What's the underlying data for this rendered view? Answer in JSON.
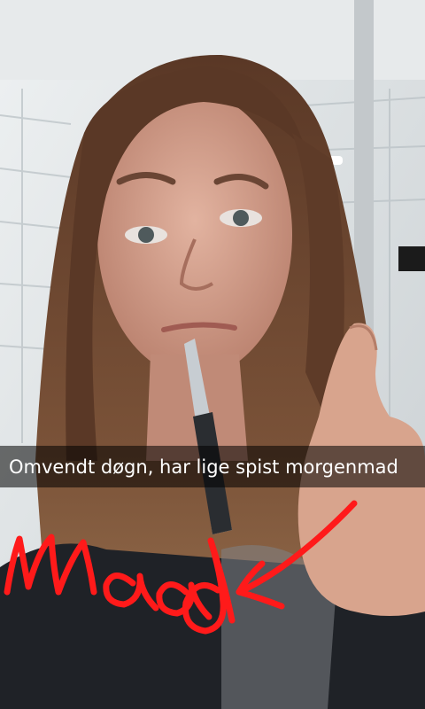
{
  "caption": {
    "text": "Omvendt døgn, har lige spist morgenmad"
  },
  "drawing": {
    "word": "Maad",
    "color": "#ff1a1a"
  },
  "colors": {
    "caption_bar": "rgba(0,0,0,0.55)",
    "caption_text": "#ffffff",
    "wall": "#dfe4e6",
    "hair": "#6b4630",
    "skin": "#cf9a86"
  },
  "icons": {
    "arrow": "arrow-icon"
  }
}
